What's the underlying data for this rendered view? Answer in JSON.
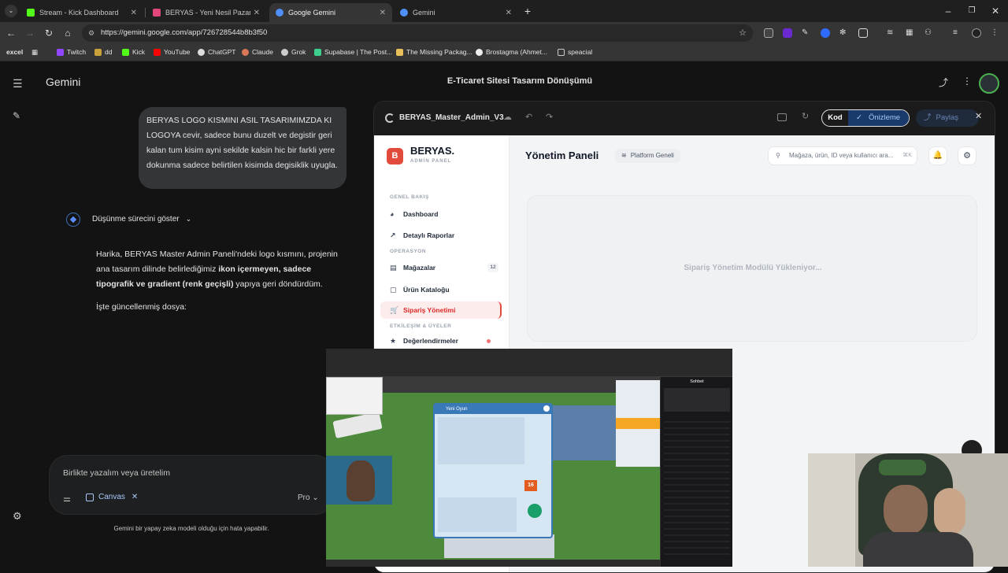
{
  "browser": {
    "tabs": [
      {
        "title": "Stream - Kick Dashboard",
        "favicon_color": "#53fc18"
      },
      {
        "title": "BERYAS - Yeni Nesil Pazar Yeri",
        "favicon_color": "#e0457b"
      },
      {
        "title": "Google Gemini",
        "favicon_color": "#4f8ff7",
        "active": true
      },
      {
        "title": "Gemini",
        "favicon_color": "#4f8ff7"
      }
    ],
    "url": "https://gemini.google.com/app/726728544b8b3f50",
    "bookmarks": [
      {
        "label": "excel"
      },
      {
        "label": "Twitch"
      },
      {
        "label": "dd"
      },
      {
        "label": "Kick"
      },
      {
        "label": "YouTube"
      },
      {
        "label": "ChatGPT"
      },
      {
        "label": "Claude"
      },
      {
        "label": "Grok"
      },
      {
        "label": "Supabase | The Post..."
      },
      {
        "label": "The Missing Packag..."
      },
      {
        "label": "Brostagma (Ahmet..."
      },
      {
        "label": "speacial"
      }
    ]
  },
  "gemini": {
    "brand": "Gemini",
    "chat_title": "E-Ticaret Sitesi Tasarım Dönüşümü",
    "user_message": "BERYAS LOGO KISMINI ASIL TASARIMIMZDA KI LOGOYA cevir, sadece bunu duzelt ve degistir geri kalan tum kisim ayni sekilde kalsin hic bir farkli yere dokunma sadece belirtilen kisimda degisiklik uyugla.",
    "thinking_toggle": "Düşünme sürecini göster",
    "reply_pre": "Harika, BERYAS Master Admin Paneli'ndeki logo kısmını, projenin ana tasarım dilinde belirlediğimiz ",
    "reply_bold1": "ikon içermeyen, sadece tipografik ve gradient (renk geçişli)",
    "reply_post": " yapıya geri döndürdüm.",
    "reply_line2": "İşte güncellenmiş dosya:",
    "composer_placeholder": "Birlikte yazalım veya üretelim",
    "canvas_chip": "Canvas",
    "model": "Pro",
    "disclaimer": "Gemini bir yapay zeka modeli olduğu için hata yapabilir."
  },
  "canvas": {
    "file_name": "BERYAS_Master_Admin_V3",
    "code_btn": "Kod",
    "preview_btn": "Önizleme",
    "share_btn": "Paylaş"
  },
  "admin": {
    "logo_letter": "B",
    "logo_title": "BERYAS.",
    "logo_sub": "ADMİN PANEL",
    "page_title": "Yönetim Paneli",
    "scope_badge": "Platform Geneli",
    "search_placeholder": "Mağaza, ürün, ID veya kullanıcı ara...",
    "search_shortcut": "⌘K",
    "loading_text": "Sipariş Yönetim Modülü Yükleniyor...",
    "sections": {
      "overview": "GENEL BAKIŞ",
      "operation": "OPERASYON",
      "engagement": "ETKİLEŞİM & ÜYELER"
    },
    "nav": [
      {
        "label": "Dashboard"
      },
      {
        "label": "Detaylı Raporlar"
      },
      {
        "label": "Mağazalar",
        "badge": "12"
      },
      {
        "label": "Ürün Kataloğu"
      },
      {
        "label": "Sipariş Yönetimi",
        "active": true
      },
      {
        "label": "Değerlendirmeler"
      }
    ]
  },
  "overlay": {
    "game_dialog_title": "Yeni Oyun",
    "chat_header": "Sohbet",
    "game_counter": "16"
  }
}
